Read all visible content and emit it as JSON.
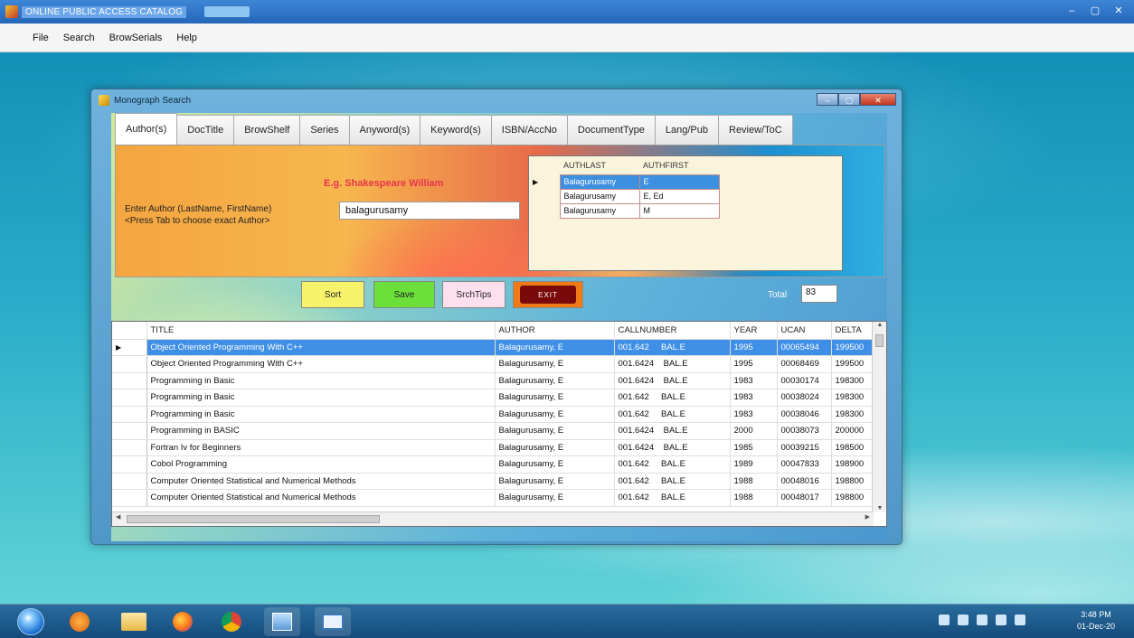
{
  "window": {
    "title": "ONLINE PUBLIC ACCESS CATALOG",
    "controls": {
      "minimize": "–",
      "maximize": "▢",
      "close": "✕"
    }
  },
  "menu": {
    "items": [
      "File",
      "Search",
      "BrowSerials",
      "Help"
    ]
  },
  "dialog": {
    "title": "Monograph Search",
    "tabs": [
      "Author(s)",
      "DocTitle",
      "BrowShelf",
      "Series",
      "Anyword(s)",
      "Keyword(s)",
      "ISBN/AccNo",
      "DocumentType",
      "Lang/Pub",
      "Review/ToC"
    ],
    "active_tab": 0,
    "eg_text": "E.g. Shakespeare William",
    "enter_label": "Enter Author (LastName, FirstName)\n<Press Tab to choose exact Author>",
    "author_input_value": "balagurusamy",
    "author_grid": {
      "columns": [
        "AUTHLAST",
        "AUTHFIRST"
      ],
      "rows": [
        [
          "Balagurusamy",
          "E"
        ],
        [
          "Balagurusamy",
          "E, Ed"
        ],
        [
          "Balagurusamy",
          "M"
        ]
      ],
      "selected_row": 0
    },
    "buttons": {
      "sort": "Sort",
      "save": "Save",
      "search_tips": "SrchTips",
      "exit": "EXIT"
    },
    "total_label": "Total",
    "total_value": "83",
    "results": {
      "columns": [
        "TITLE",
        "AUTHOR",
        "CALLNUMBER",
        "YEAR",
        "UCAN",
        "DELTA"
      ],
      "rows": [
        [
          "Object Oriented Programming With C++",
          "Balagurusamy, E",
          "001.642     BAL.E",
          "1995",
          "00065494",
          "199500"
        ],
        [
          "Object Oriented Programming With C++",
          "Balagurusamy, E",
          "001.6424    BAL.E",
          "1995",
          "00068469",
          "199500"
        ],
        [
          "Programming in Basic",
          "Balagurusamy, E",
          "001.6424    BAL.E",
          "1983",
          "00030174",
          "198300"
        ],
        [
          "Programming in Basic",
          "Balagurusamy, E",
          "001.642     BAL.E",
          "1983",
          "00038024",
          "198300"
        ],
        [
          "Programming in Basic",
          "Balagurusamy, E",
          "001.642     BAL.E",
          "1983",
          "00038046",
          "198300"
        ],
        [
          "Programming in BASIC",
          "Balagurusamy, E",
          "001.6424    BAL.E",
          "2000",
          "00038073",
          "200000"
        ],
        [
          "Fortran Iv for Beginners",
          "Balagurusamy, E",
          "001.6424    BAL.E",
          "1985",
          "00039215",
          "198500"
        ],
        [
          "Cobol Programming",
          "Balagurusamy, E",
          "001.642     BAL.E",
          "1989",
          "00047833",
          "198900"
        ],
        [
          "Computer Oriented Statistical and Numerical Methods",
          "Balagurusamy, E",
          "001.642     BAL.E",
          "1988",
          "00048016",
          "198800"
        ],
        [
          "Computer Oriented Statistical and Numerical Methods",
          "Balagurusamy, E",
          "001.642     BAL.E",
          "1988",
          "00048017",
          "198800"
        ]
      ],
      "selected_row": 0
    }
  },
  "taskbar": {
    "clock_time": "3:48 PM",
    "clock_date": "01-Dec-20",
    "apps": [
      "start-button",
      "media-player-icon",
      "file-explorer-icon",
      "firefox-icon",
      "chrome-icon",
      "catalog-app-icon",
      "window-app-icon"
    ]
  },
  "colors": {
    "sort": "#f6f36a",
    "save": "#6be03b",
    "search_tips": "#fde0ee",
    "exit_outer": "#f07a18",
    "exit_inner": "#7a0a0a",
    "selection": "#3f8fe6",
    "eg_text": "#e8354b"
  }
}
